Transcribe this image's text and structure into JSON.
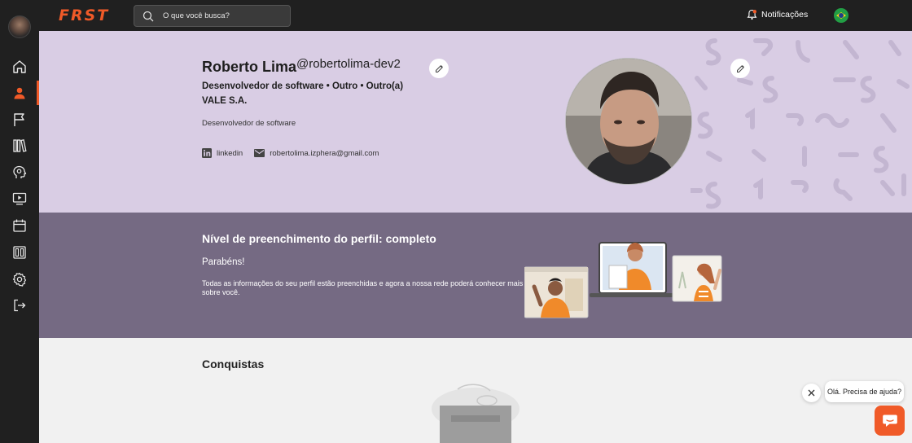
{
  "header": {
    "logo": "FRST",
    "search_placeholder": "O que você busca?",
    "notifications_label": "Notificações"
  },
  "sidebar": {
    "items": [
      {
        "name": "home",
        "icon": "home-icon"
      },
      {
        "name": "profile",
        "icon": "user-icon",
        "active": true
      },
      {
        "name": "flag",
        "icon": "flag-icon"
      },
      {
        "name": "library",
        "icon": "library-icon"
      },
      {
        "name": "mentoring",
        "icon": "head-icon"
      },
      {
        "name": "videos",
        "icon": "play-icon"
      },
      {
        "name": "calendar",
        "icon": "calendar-icon"
      },
      {
        "name": "boards",
        "icon": "board-icon"
      },
      {
        "name": "settings",
        "icon": "gear-icon"
      },
      {
        "name": "logout",
        "icon": "logout-icon"
      }
    ]
  },
  "profile": {
    "name": "Roberto Lima",
    "handle": "@robertolima-dev2",
    "role_line": "Desenvolvedor de software • Outro • Outro(a)",
    "company": "VALE S.A.",
    "bio": "Desenvolvedor de software",
    "linkedin_label": "linkedin",
    "email": "robertolima.izphera@gmail.com"
  },
  "completion": {
    "title": "Nível de preenchimento do perfil: completo",
    "subtitle": "Parabéns!",
    "text": "Todas as informações do seu perfil estão preenchidas e agora a nossa rede poderá conhecer mais sobre você."
  },
  "achievements": {
    "title": "Conquistas"
  },
  "chat": {
    "bubble_text": "Olá. Precisa de ajuda?"
  },
  "colors": {
    "accent": "#f05a28",
    "banner_bg": "#d9cde4",
    "completion_bg": "#756a83",
    "topbar_bg": "#202020"
  }
}
